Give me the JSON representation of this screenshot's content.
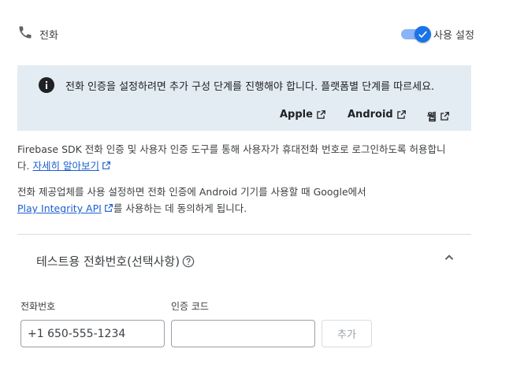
{
  "header": {
    "provider_name": "전화",
    "toggle_label": "사용 설정",
    "toggle_on": true
  },
  "banner": {
    "text": "전화 인증을 설정하려면 추가 구성 단계를 진행해야 합니다. 플랫폼별 단계를 따르세요.",
    "links": [
      "Apple",
      "Android",
      "웹"
    ]
  },
  "description": {
    "line1": "Firebase SDK 전화 인증 및 사용자 인증 도구를 통해 사용자가 휴대전화 번호로 로그인하도록 허용합니",
    "line2_prefix": "다.",
    "learn_more": "자세히 알아보기",
    "consent_line1": "전화 제공업체를 사용 설정하면 전화 인증에 Android 기기를 사용할 때 Google에서",
    "consent_link": "Play Integrity API",
    "consent_suffix": "를 사용하는 데 동의하게 됩니다."
  },
  "test_numbers": {
    "title": "테스트용 전화번호(선택사항)",
    "phone_label": "전화번호",
    "phone_value": "+1 650-555-1234",
    "code_label": "인증 코드",
    "code_value": "",
    "add_button": "추가"
  },
  "colors": {
    "accent": "#1a73e8",
    "banner_bg": "#e3ebf3",
    "link": "#1a5fd0"
  }
}
